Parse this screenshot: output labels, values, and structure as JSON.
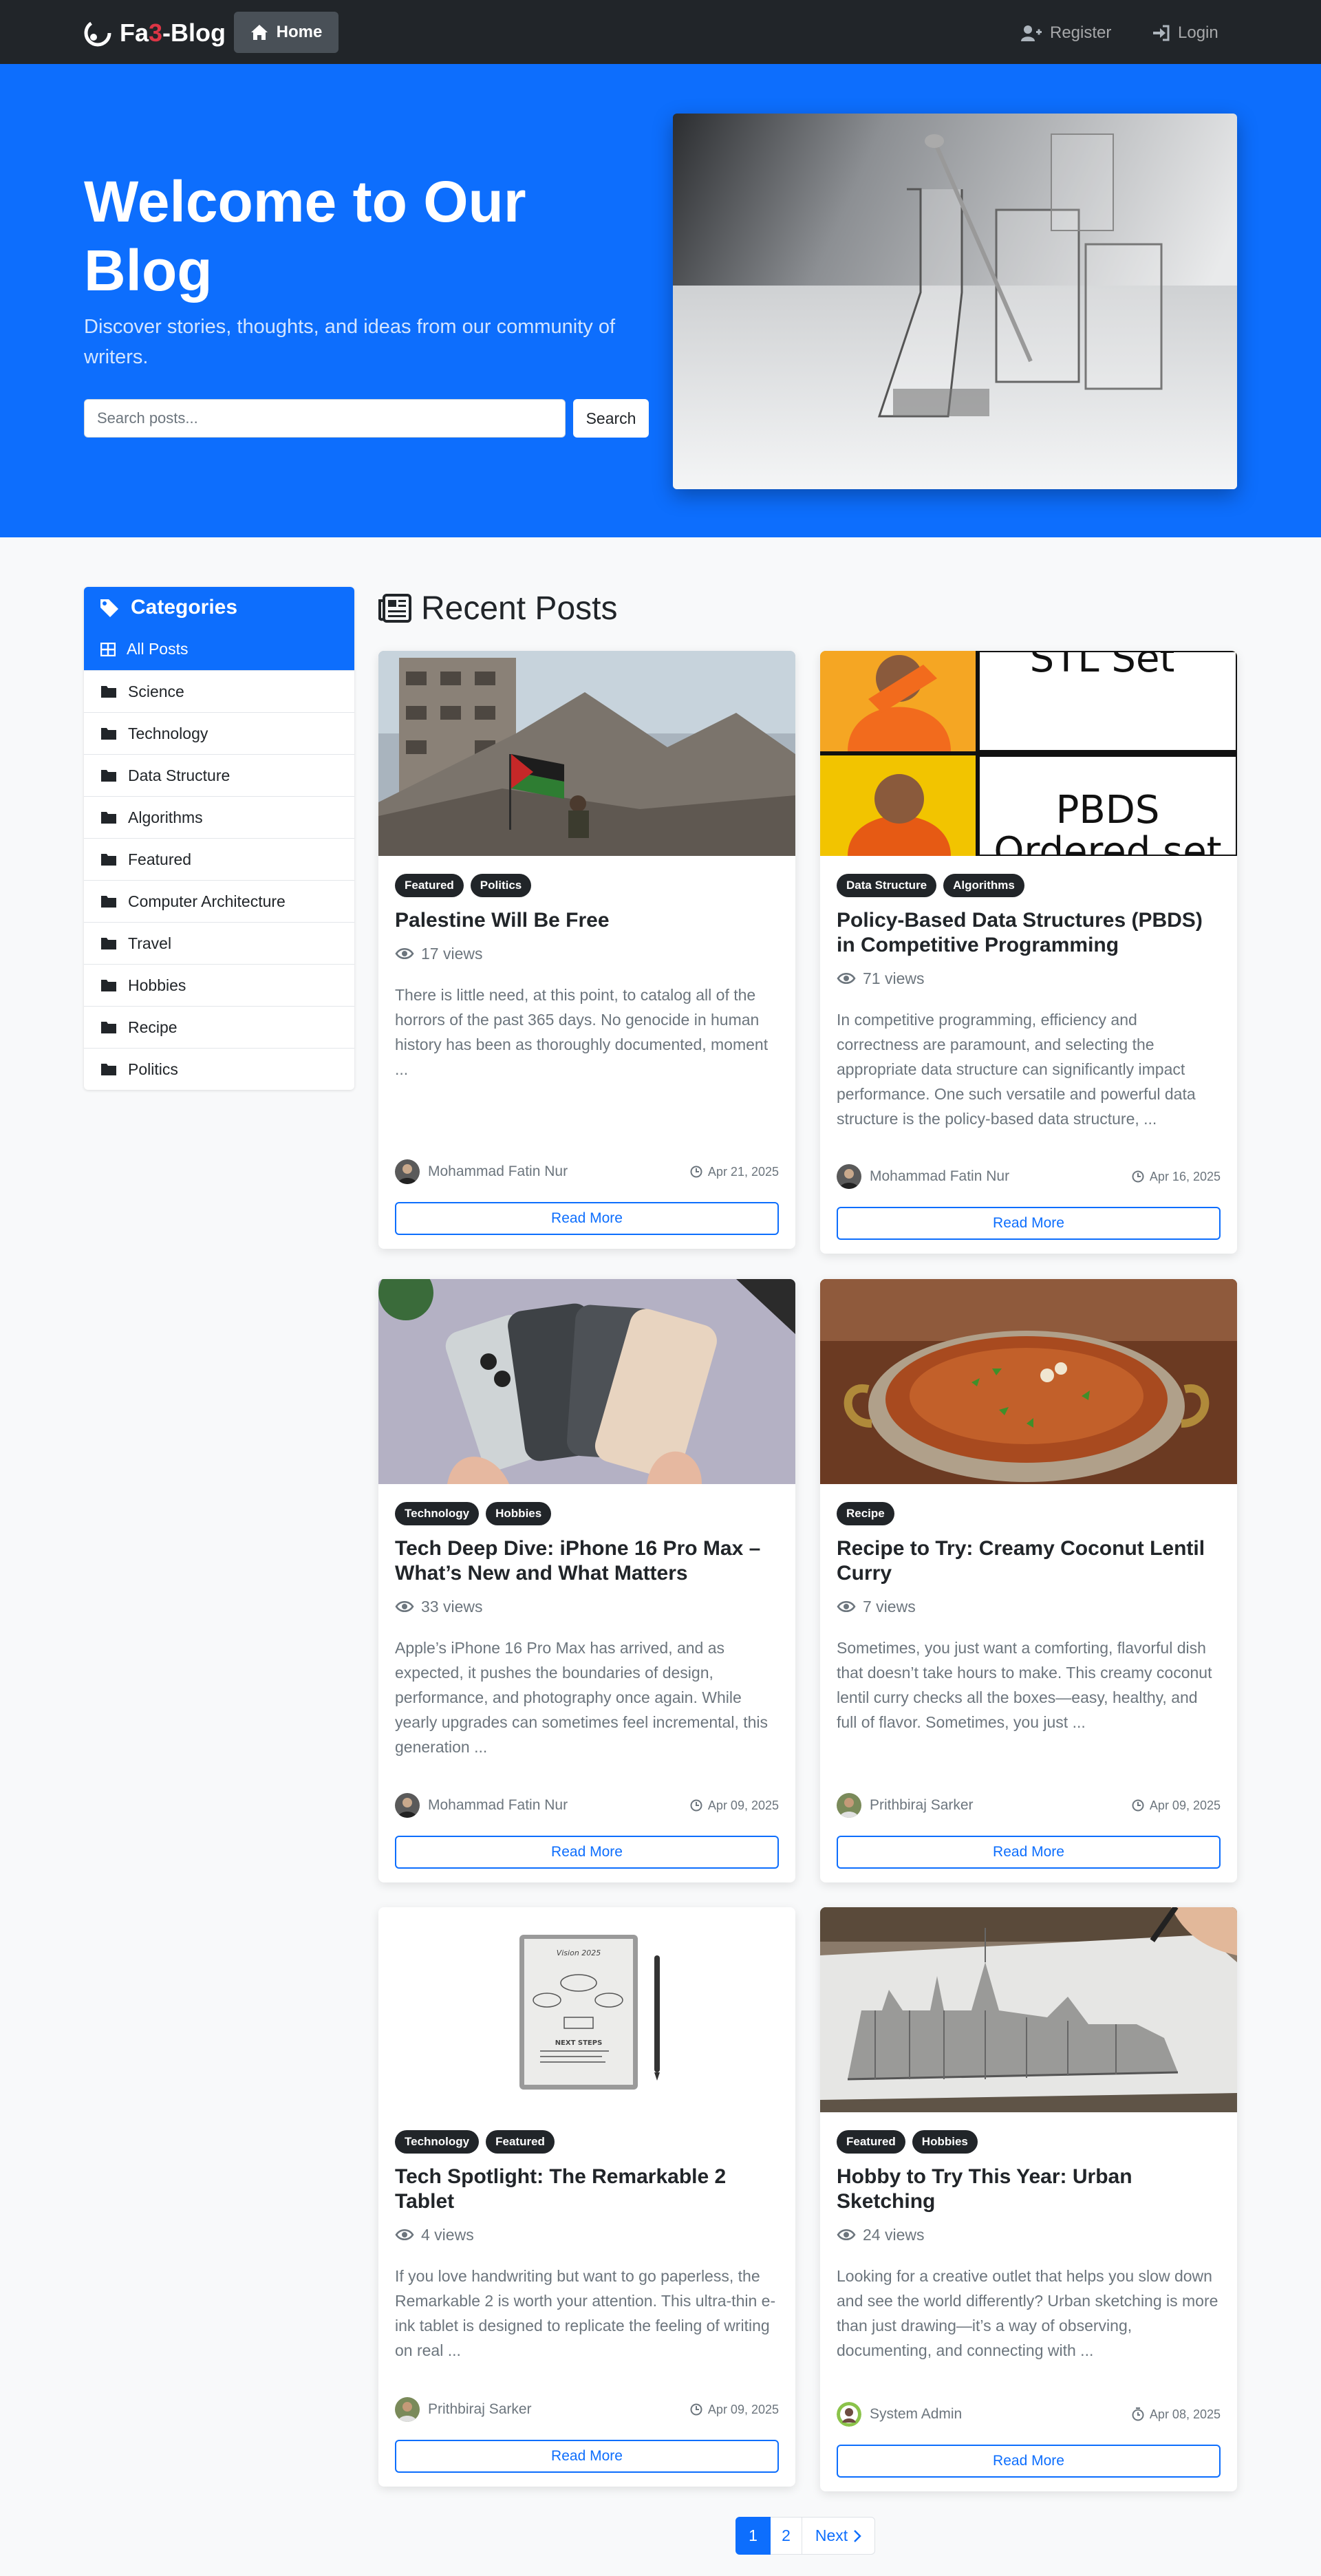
{
  "nav": {
    "brand_prefix": "Fa",
    "brand_three": "3",
    "brand_suffix": "-Blog",
    "home": "Home",
    "register": "Register",
    "login": "Login"
  },
  "hero": {
    "title": "Welcome to Our Blog",
    "subtitle": "Discover stories, thoughts, and ideas from our community of writers.",
    "search_placeholder": "Search posts...",
    "search_button": "Search"
  },
  "sidebar": {
    "title": "Categories",
    "items": [
      {
        "label": "All Posts",
        "icon": "grid-icon",
        "active": true
      },
      {
        "label": "Science",
        "icon": "folder-icon"
      },
      {
        "label": "Technology",
        "icon": "folder-icon"
      },
      {
        "label": "Data Structure",
        "icon": "folder-icon"
      },
      {
        "label": "Algorithms",
        "icon": "folder-icon"
      },
      {
        "label": "Featured",
        "icon": "folder-icon"
      },
      {
        "label": "Computer Architecture",
        "icon": "folder-icon"
      },
      {
        "label": "Travel",
        "icon": "folder-icon"
      },
      {
        "label": "Hobbies",
        "icon": "folder-icon"
      },
      {
        "label": "Recipe",
        "icon": "folder-icon"
      },
      {
        "label": "Politics",
        "icon": "folder-icon"
      }
    ]
  },
  "main": {
    "title": "Recent Posts",
    "read_more": "Read More"
  },
  "posts": [
    {
      "badges": [
        "Featured",
        "Politics"
      ],
      "title": "Palestine Will Be Free",
      "views": "17 views",
      "excerpt": "There is little need, at this point, to catalog all of the horrors of the past 365 days. No genocide in human history has been as thoroughly documented, moment ...",
      "author": "Mohammad Fatin Nur",
      "date": "Apr 21, 2025"
    },
    {
      "badges": [
        "Data Structure",
        "Algorithms"
      ],
      "title": "Policy-Based Data Structures (PBDS) in Competitive Programming",
      "views": "71 views",
      "excerpt": "In competitive programming, efficiency and correctness are paramount, and selecting the appropriate data structure can significantly impact performance. One such versatile and powerful data structure is the policy-based data structure, ...",
      "author": "Mohammad Fatin Nur",
      "date": "Apr 16, 2025",
      "image_text": [
        "STL Set",
        "PBDS",
        "Ordered set"
      ]
    },
    {
      "badges": [
        "Technology",
        "Hobbies"
      ],
      "title": "Tech Deep Dive: iPhone 16 Pro Max – What’s New and What Matters",
      "views": "33 views",
      "excerpt": "Apple’s iPhone 16 Pro Max has arrived, and as expected, it pushes the boundaries of design, performance, and photography once again. While yearly upgrades can sometimes feel incremental, this generation ...",
      "author": "Mohammad Fatin Nur",
      "date": "Apr 09, 2025"
    },
    {
      "badges": [
        "Recipe"
      ],
      "title": "Recipe to Try: Creamy Coconut Lentil Curry",
      "views": "7 views",
      "excerpt": "Sometimes, you just want a comforting, flavorful dish that doesn’t take hours to make. This creamy coconut lentil curry checks all the boxes—easy, healthy, and full of flavor. Sometimes, you just ...",
      "author": "Prithbiraj Sarker",
      "date": "Apr 09, 2025"
    },
    {
      "badges": [
        "Technology",
        "Featured"
      ],
      "title": "Tech Spotlight: The Remarkable 2 Tablet",
      "views": "4 views",
      "excerpt": "If you love handwriting but want to go paperless, the Remarkable 2 is worth your attention. This ultra-thin e-ink tablet is designed to replicate the feeling of writing on real ...",
      "author": "Prithbiraj Sarker",
      "date": "Apr 09, 2025",
      "image_text": [
        "Vision 2025",
        "NEXT STEPS"
      ]
    },
    {
      "badges": [
        "Featured",
        "Hobbies"
      ],
      "title": "Hobby to Try This Year: Urban Sketching",
      "views": "24 views",
      "excerpt": "Looking for a creative outlet that helps you slow down and see the world differently? Urban sketching is more than just drawing—it’s a way of observing, documenting, and connecting with ...",
      "author": "System Admin",
      "date": "Apr 08, 2025"
    }
  ],
  "pagination": {
    "page1": "1",
    "page2": "2",
    "next": "Next"
  },
  "colors": {
    "primary": "#0d6efd",
    "navbar": "#212529",
    "badge": "#212529",
    "brand_accent": "#dc3545"
  }
}
